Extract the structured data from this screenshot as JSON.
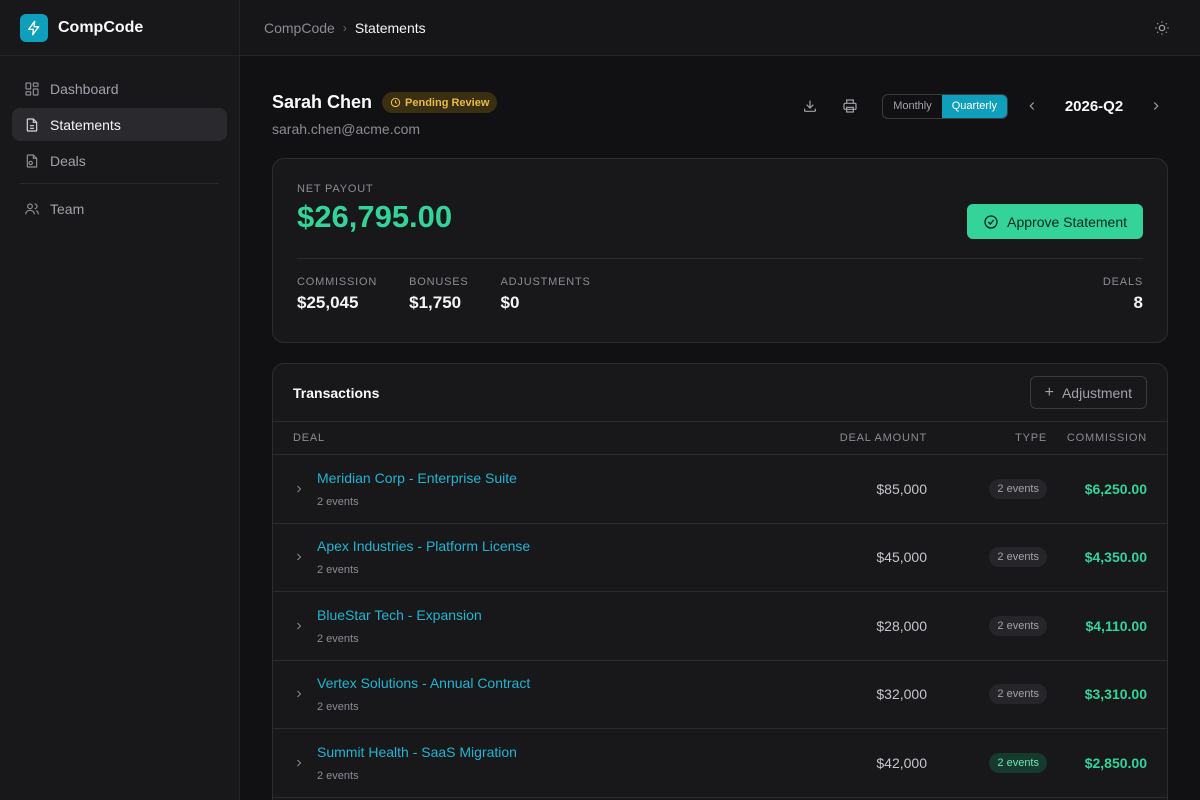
{
  "brand": {
    "name": "CompCode",
    "accent": "#0e9fbd"
  },
  "sidebar": {
    "items": [
      {
        "label": "Dashboard",
        "icon": "dashboard-icon"
      },
      {
        "label": "Statements",
        "icon": "document-icon",
        "active": true
      },
      {
        "label": "Deals",
        "icon": "deal-file-icon"
      },
      {
        "label": "Team",
        "icon": "users-icon"
      }
    ]
  },
  "breadcrumb": {
    "root": "CompCode",
    "current": "Statements"
  },
  "statement": {
    "name": "Sarah Chen",
    "status": "Pending Review",
    "email": "sarah.chen@acme.com"
  },
  "controls": {
    "monthly": "Monthly",
    "quarterly": "Quarterly",
    "period": "2026-Q2"
  },
  "payout": {
    "label": "NET PAYOUT",
    "amount": "$26,795.00",
    "approve_label": "Approve Statement",
    "stats": {
      "commission_label": "COMMISSION",
      "commission": "$25,045",
      "bonuses_label": "BONUSES",
      "bonuses": "$1,750",
      "adjustments_label": "ADJUSTMENTS",
      "adjustments": "$0",
      "deals_label": "DEALS",
      "deals": "8"
    }
  },
  "transactions": {
    "title": "Transactions",
    "add_label": "Adjustment",
    "columns": {
      "deal": "DEAL",
      "amount": "DEAL AMOUNT",
      "type": "TYPE",
      "commission": "COMMISSION"
    },
    "rows": [
      {
        "deal": "Meridian Corp - Enterprise Suite",
        "events": "2 events",
        "amount": "$85,000",
        "type": "2 events",
        "commission": "$6,250.00"
      },
      {
        "deal": "Apex Industries - Platform License",
        "events": "2 events",
        "amount": "$45,000",
        "type": "2 events",
        "commission": "$4,350.00"
      },
      {
        "deal": "BlueStar Tech - Expansion",
        "events": "2 events",
        "amount": "$28,000",
        "type": "2 events",
        "commission": "$4,110.00"
      },
      {
        "deal": "Vertex Solutions - Annual Contract",
        "events": "2 events",
        "amount": "$32,000",
        "type": "2 events",
        "commission": "$3,310.00"
      },
      {
        "deal": "Summit Health - SaaS Migration",
        "events": "2 events",
        "amount": "$42,000",
        "type": "2 events",
        "commission": "$2,850.00"
      }
    ]
  }
}
